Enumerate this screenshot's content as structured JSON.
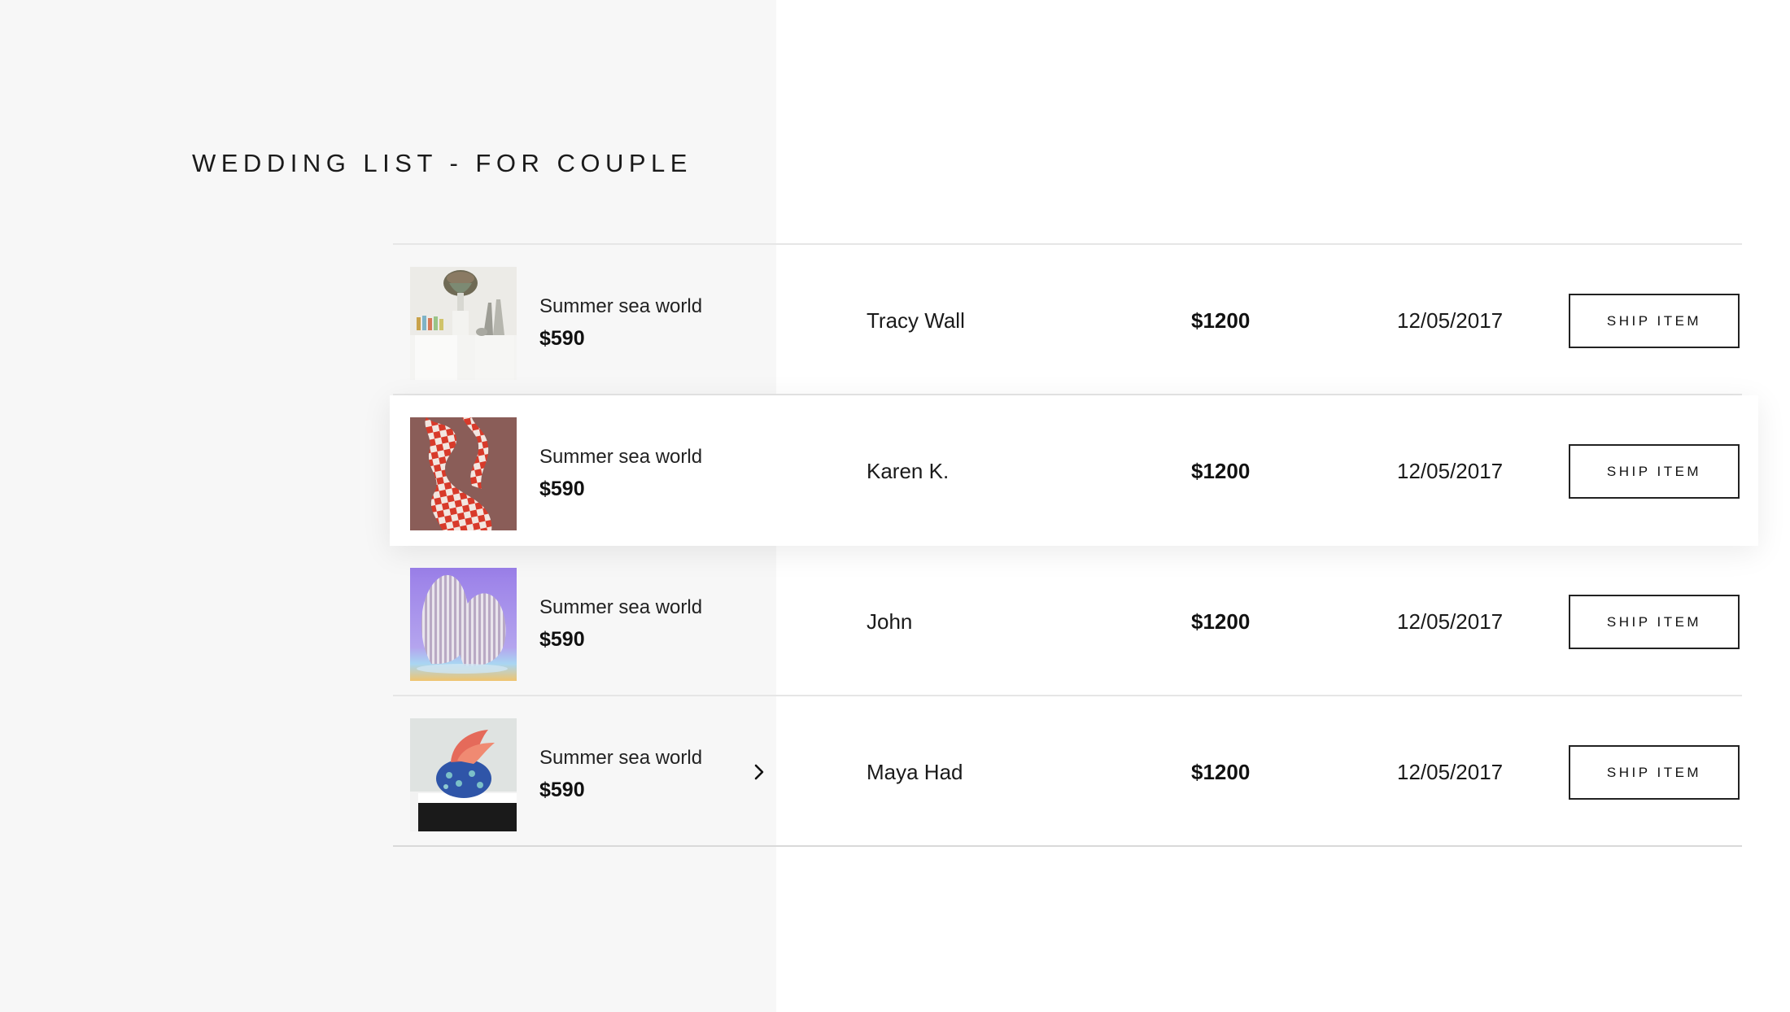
{
  "page": {
    "title": "WEDDING LIST - FOR COUPLE"
  },
  "colors": {
    "background": "#ffffff",
    "left_panel": "#f7f7f7",
    "divider": "#e6e6e6",
    "text": "#1a1a1a"
  },
  "rows": [
    {
      "item_name": "Summer sea world",
      "item_price": "$590",
      "guest": "Tracy Wall",
      "amount": "$1200",
      "date": "12/05/2017",
      "action_label": "SHIP ITEM",
      "thumbnail": "vases-on-pedestals-image"
    },
    {
      "item_name": "Summer sea world",
      "item_price": "$590",
      "guest": "Karen K.",
      "amount": "$1200",
      "date": "12/05/2017",
      "action_label": "SHIP ITEM",
      "thumbnail": "checkered-figure-image",
      "highlighted": true
    },
    {
      "item_name": "Summer sea world",
      "item_price": "$590",
      "guest": "John",
      "amount": "$1200",
      "date": "12/05/2017",
      "action_label": "SHIP ITEM",
      "thumbnail": "ribbed-shells-image"
    },
    {
      "item_name": "Summer sea world",
      "item_price": "$590",
      "guest": "Maya Had",
      "amount": "$1200",
      "date": "12/05/2017",
      "action_label": "SHIP ITEM",
      "thumbnail": "coral-sculpture-image",
      "expand_icon": "chevron-right-icon"
    }
  ]
}
